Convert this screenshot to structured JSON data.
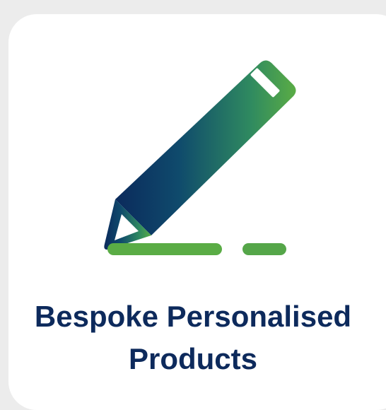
{
  "card": {
    "title_line1": "Bespoke Personalised",
    "title_line2": "Products",
    "icon": "pencil-writing-icon"
  },
  "colors": {
    "background": "#ececec",
    "card": "#ffffff",
    "title": "#0d2a5c",
    "gradient_start": "#0b2a5c",
    "gradient_end": "#5aac45"
  }
}
